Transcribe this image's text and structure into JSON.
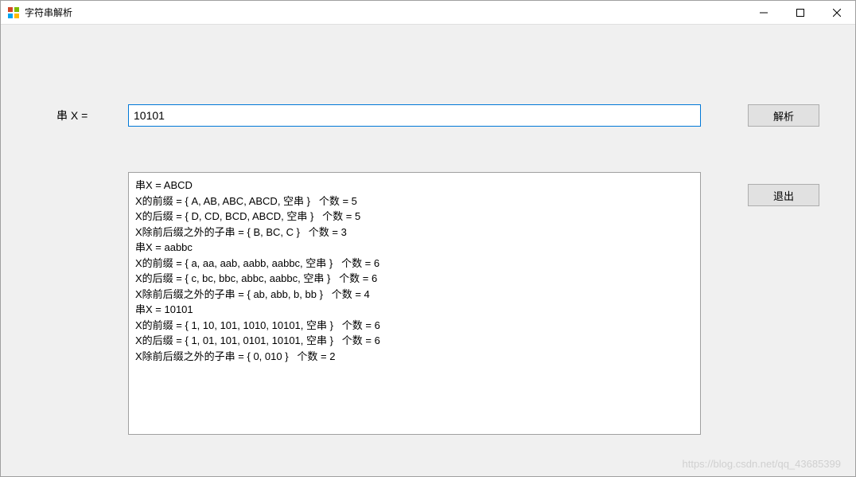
{
  "window": {
    "title": "字符串解析"
  },
  "form": {
    "label_x": "串 X =",
    "input_value": "10101"
  },
  "buttons": {
    "parse": "解析",
    "exit": "退出"
  },
  "output_lines": [
    "串X = ABCD",
    "X的前缀 = { A, AB, ABC, ABCD, 空串 }   个数 = 5",
    "X的后缀 = { D, CD, BCD, ABCD, 空串 }   个数 = 5",
    "X除前后缀之外的子串 = { B, BC, C }   个数 = 3",
    "串X = aabbc",
    "X的前缀 = { a, aa, aab, aabb, aabbc, 空串 }   个数 = 6",
    "X的后缀 = { c, bc, bbc, abbc, aabbc, 空串 }   个数 = 6",
    "X除前后缀之外的子串 = { ab, abb, b, bb }   个数 = 4",
    "串X = 10101",
    "X的前缀 = { 1, 10, 101, 1010, 10101, 空串 }   个数 = 6",
    "X的后缀 = { 1, 01, 101, 0101, 10101, 空串 }   个数 = 6",
    "X除前后缀之外的子串 = { 0, 010 }   个数 = 2"
  ],
  "watermark": "https://blog.csdn.net/qq_43685399"
}
